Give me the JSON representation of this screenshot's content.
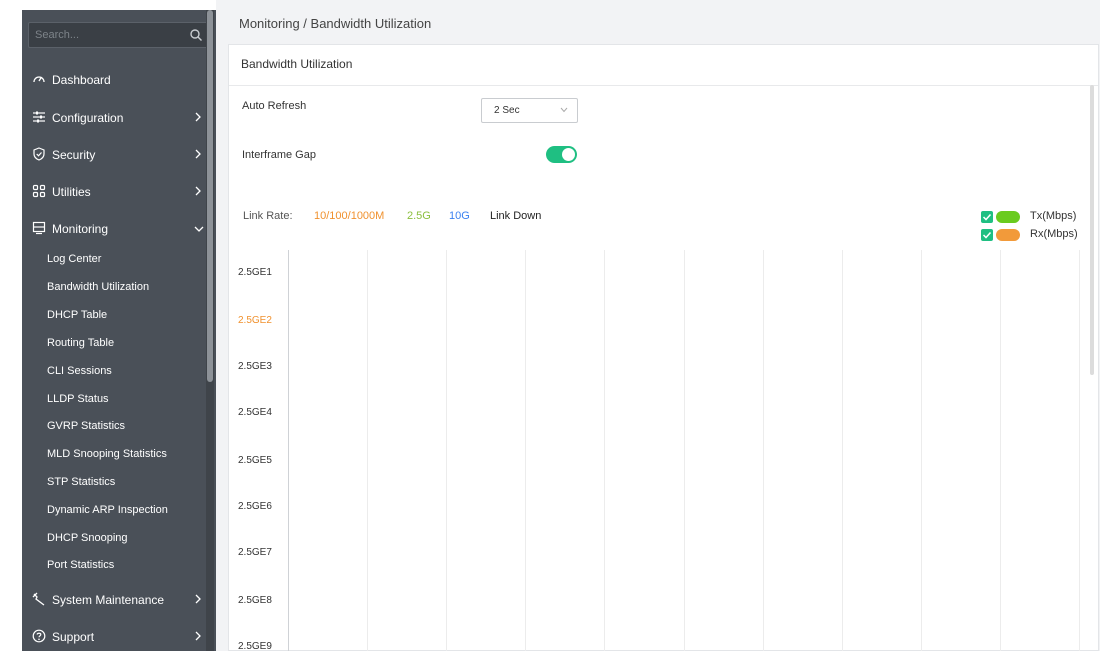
{
  "sidebar": {
    "search_placeholder": "Search...",
    "items": [
      {
        "label": "Dashboard",
        "icon": "dashboard-icon",
        "has_chevron": false
      },
      {
        "label": "Configuration",
        "icon": "sliders-icon",
        "has_chevron": true
      },
      {
        "label": "Security",
        "icon": "shield-icon",
        "has_chevron": true
      },
      {
        "label": "Utilities",
        "icon": "grid-icon",
        "has_chevron": true
      },
      {
        "label": "Monitoring",
        "icon": "monitor-icon",
        "has_chevron": true,
        "expanded": true
      }
    ],
    "monitoring_sub": [
      "Log Center",
      "Bandwidth Utilization",
      "DHCP Table",
      "Routing Table",
      "CLI Sessions",
      "LLDP Status",
      "GVRP Statistics",
      "MLD Snooping Statistics",
      "STP Statistics",
      "Dynamic ARP Inspection",
      "DHCP Snooping",
      "Port Statistics"
    ],
    "bottom_items": [
      {
        "label": "System Maintenance",
        "icon": "wrench-icon",
        "has_chevron": true
      },
      {
        "label": "Support",
        "icon": "help-icon",
        "has_chevron": true
      }
    ]
  },
  "breadcrumb": "Monitoring /  Bandwidth Utilization",
  "card_title": "Bandwidth Utilization",
  "auto_refresh": {
    "label": "Auto Refresh",
    "value": "2 Sec"
  },
  "interframe_gap": {
    "label": "Interframe Gap",
    "enabled": true
  },
  "link_rate": {
    "label": "Link Rate:",
    "items": [
      {
        "text": "10/100/1000M",
        "color": "#f0912e"
      },
      {
        "text": "2.5G",
        "color": "#8bbf3d"
      },
      {
        "text": "10G",
        "color": "#3b82f0"
      },
      {
        "text": "Link Down",
        "color": "#222222"
      }
    ]
  },
  "legend": [
    {
      "label": "Tx(Mbps)",
      "color": "#6acb1f",
      "checked": true
    },
    {
      "label": "Rx(Mbps)",
      "color": "#f29a3a",
      "checked": true
    }
  ],
  "ports": [
    {
      "name": "2.5GE1",
      "color": "#333333"
    },
    {
      "name": "2.5GE2",
      "color": "#f0912e"
    },
    {
      "name": "2.5GE3",
      "color": "#333333"
    },
    {
      "name": "2.5GE4",
      "color": "#333333"
    },
    {
      "name": "2.5GE5",
      "color": "#333333"
    },
    {
      "name": "2.5GE6",
      "color": "#333333"
    },
    {
      "name": "2.5GE7",
      "color": "#333333"
    },
    {
      "name": "2.5GE8",
      "color": "#333333"
    },
    {
      "name": "2.5GE9",
      "color": "#333333"
    }
  ]
}
